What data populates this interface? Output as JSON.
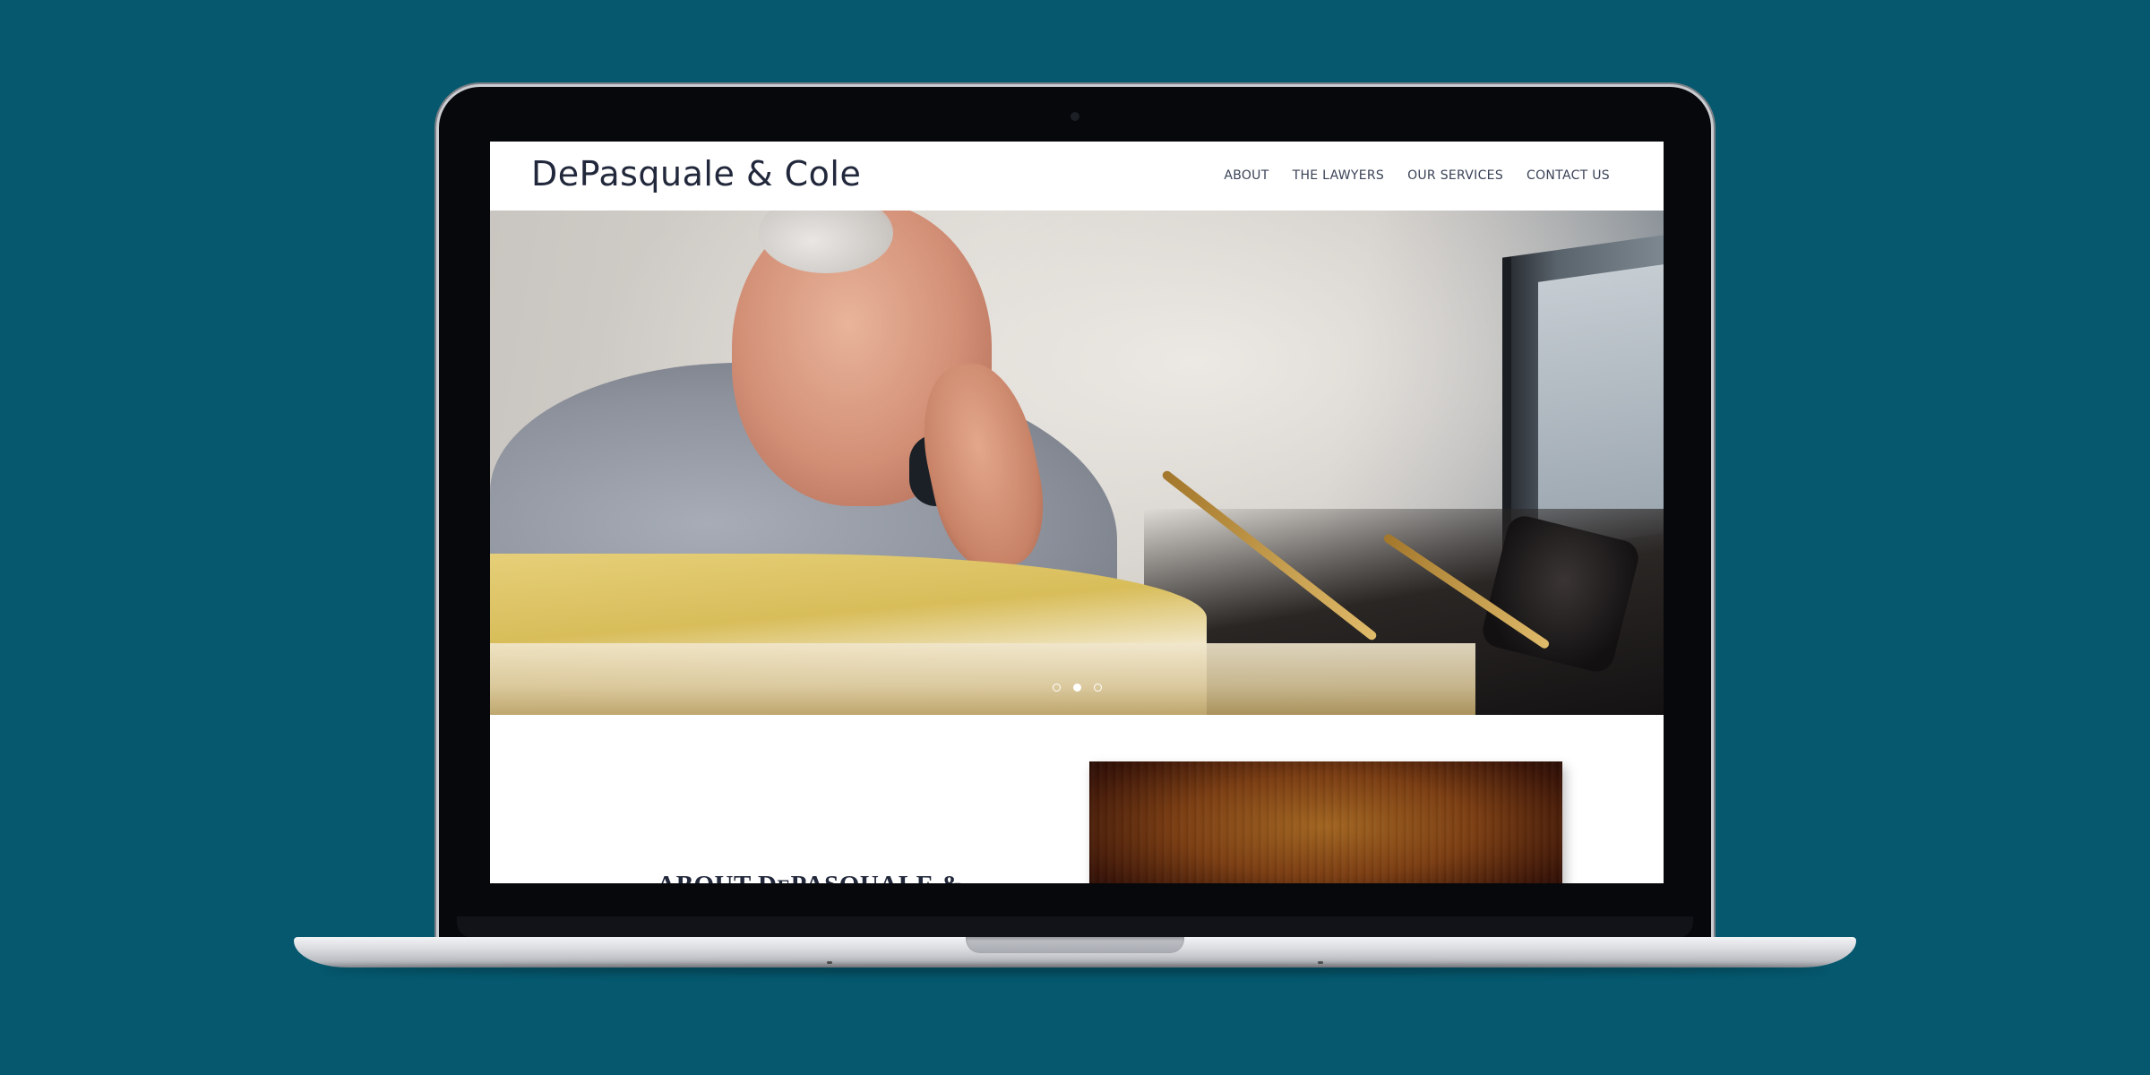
{
  "site": {
    "logo": "DePasquale & Cole",
    "nav": [
      {
        "label": "ABOUT"
      },
      {
        "label": "THE LAWYERS"
      },
      {
        "label": "OUR SERVICES"
      },
      {
        "label": "CONTACT US"
      }
    ]
  },
  "hero": {
    "slide_count": 3,
    "active_slide": 2
  },
  "about": {
    "title_prefix": "ABOUT D",
    "title_smallcaps": "E",
    "title_suffix": "PASQUALE &"
  },
  "colors": {
    "background": "#05586e",
    "text_dark": "#22283b",
    "nav_text": "#3a4256"
  }
}
